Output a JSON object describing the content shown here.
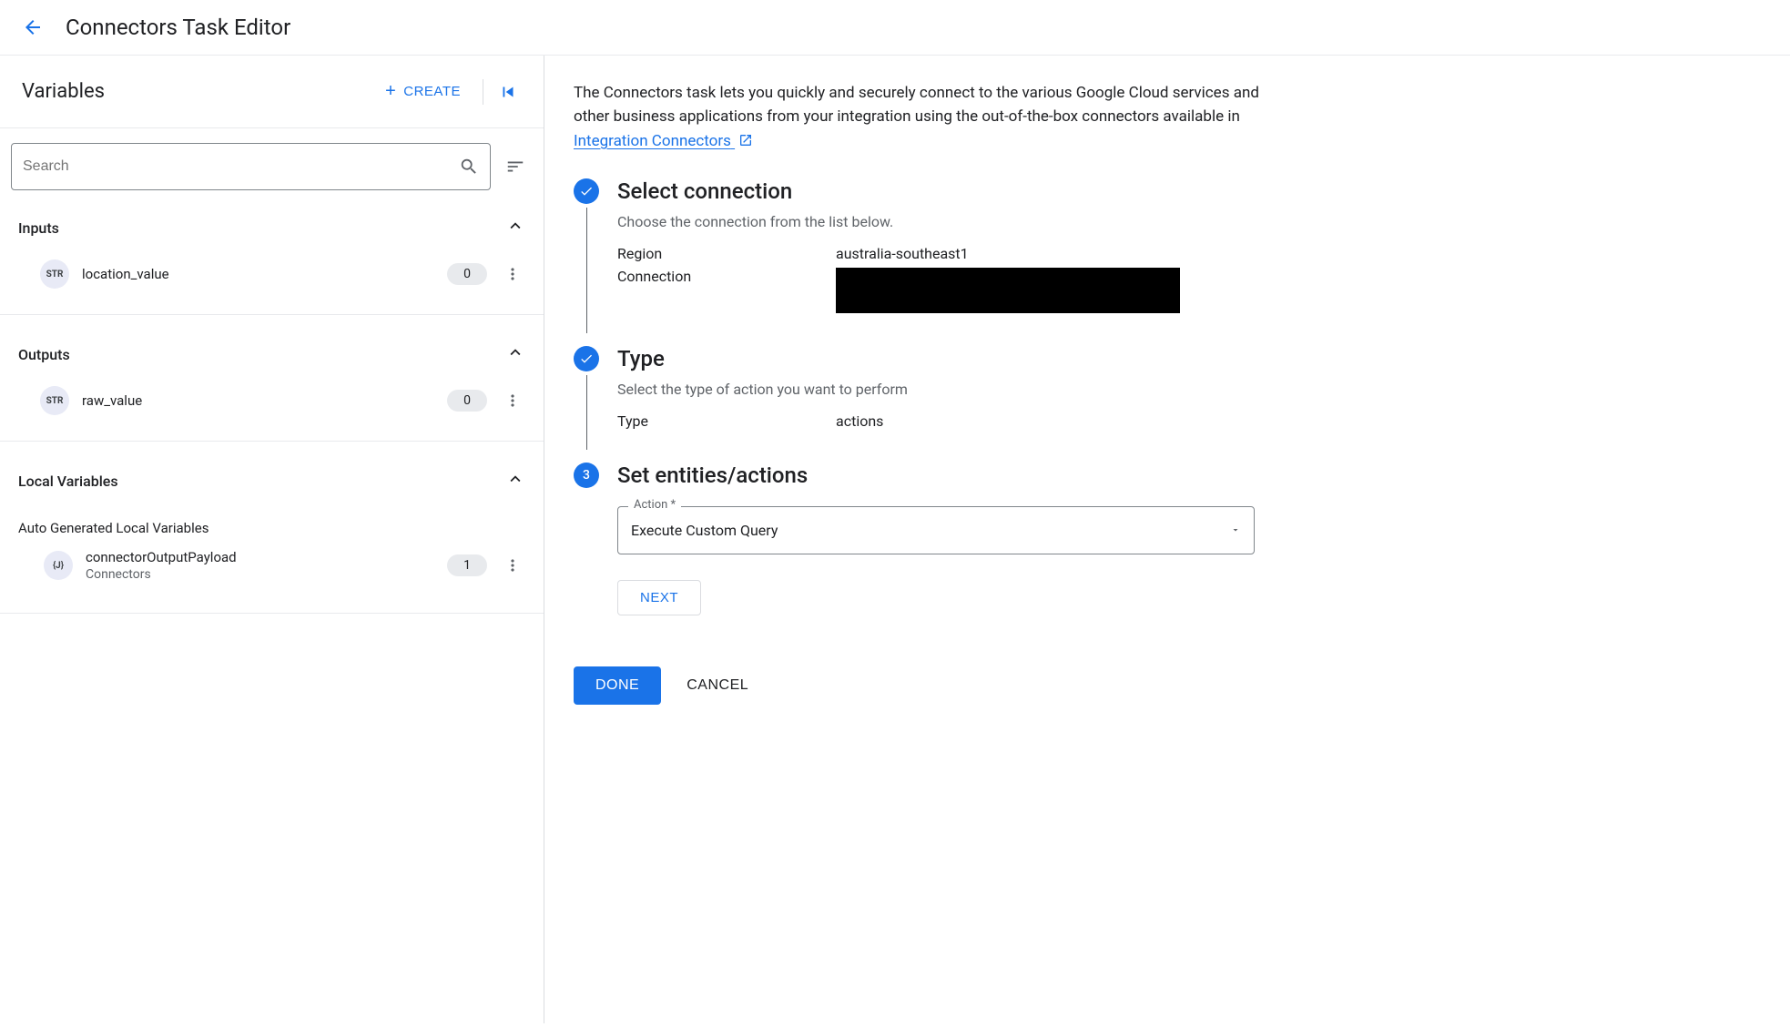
{
  "header": {
    "title": "Connectors Task Editor"
  },
  "left": {
    "panel_title": "Variables",
    "create_label": "CREATE",
    "search_placeholder": "Search",
    "sections": {
      "inputs": {
        "title": "Inputs",
        "items": [
          {
            "type_label": "STR",
            "name": "location_value",
            "count": "0"
          }
        ]
      },
      "outputs": {
        "title": "Outputs",
        "items": [
          {
            "type_label": "STR",
            "name": "raw_value",
            "count": "0"
          }
        ]
      },
      "local": {
        "title": "Local Variables",
        "sub_title": "Auto Generated Local Variables",
        "items": [
          {
            "type_label": "{J}",
            "name": "connectorOutputPayload",
            "subtitle": "Connectors",
            "count": "1"
          }
        ]
      }
    }
  },
  "right": {
    "intro_prefix": "The Connectors task lets you quickly and securely connect to the various Google Cloud services and other business applications from your integration using the out-of-the-box connectors available in ",
    "intro_link": "Integration Connectors",
    "steps": {
      "select_connection": {
        "title": "Select connection",
        "desc": "Choose the connection from the list below.",
        "region_label": "Region",
        "region_value": "australia-southeast1",
        "connection_label": "Connection"
      },
      "type": {
        "title": "Type",
        "desc": "Select the type of action you want to perform",
        "type_label": "Type",
        "type_value": "actions"
      },
      "set_entities": {
        "number": "3",
        "title": "Set entities/actions",
        "action_label": "Action *",
        "action_value": "Execute Custom Query",
        "next_label": "NEXT"
      }
    },
    "done_label": "DONE",
    "cancel_label": "CANCEL"
  }
}
